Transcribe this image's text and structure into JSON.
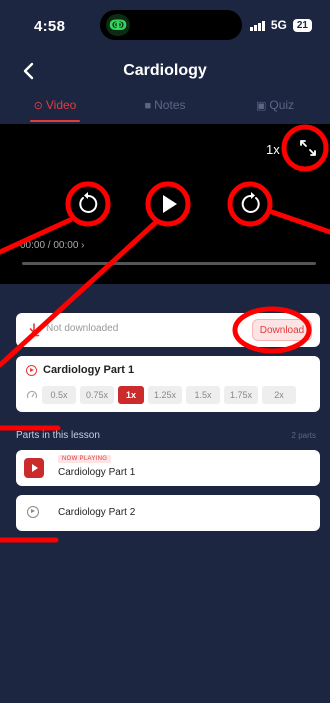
{
  "status_bar": {
    "time": "4:58",
    "network": "5G",
    "battery": "21"
  },
  "header": {
    "title": "Cardiology"
  },
  "tabs": [
    {
      "label": "Video"
    },
    {
      "label": "Notes"
    },
    {
      "label": "Quiz"
    }
  ],
  "player": {
    "speed": "1x",
    "time": "00:00 / 00:00",
    "progress": 0
  },
  "download": {
    "status": "Not downloaded",
    "button_label": "Download"
  },
  "current_part": {
    "title": "Cardiology Part 1",
    "speeds": [
      "0.5x",
      "0.75x",
      "1x",
      "1.25x",
      "1.5x",
      "1.75x",
      "2x"
    ],
    "selected_speed": "1x"
  },
  "lesson": {
    "heading": "Parts in this lesson",
    "count": "2 parts",
    "now_playing_badge": "NOW PLAYING",
    "parts": [
      {
        "title": "Cardiology Part 1"
      },
      {
        "title": "Cardiology Part 2"
      }
    ]
  },
  "colors": {
    "background": "#1c2641",
    "accent": "#e03c3c",
    "annotation": "#ff0000"
  }
}
